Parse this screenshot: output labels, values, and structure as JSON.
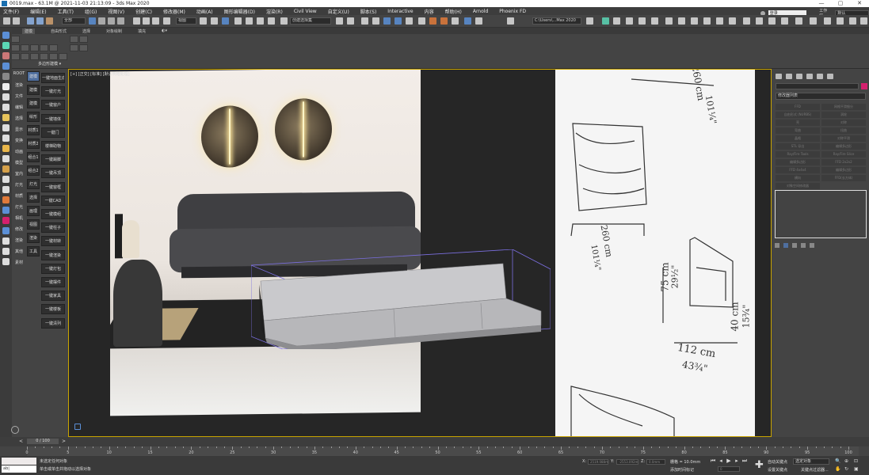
{
  "window": {
    "title": "0019.max - 63.1M @ 2021-11-03 21:13:09 - 3ds Max 2020",
    "controls": [
      "—",
      "▢",
      "✕"
    ]
  },
  "menu": {
    "items": [
      "文件(F)",
      "编辑(E)",
      "工具(T)",
      "组(G)",
      "视图(V)",
      "创建(C)",
      "修改器(M)",
      "动画(A)",
      "图形编辑器(D)",
      "渲染(R)",
      "Civil View",
      "自定义(U)",
      "脚本(S)",
      "Interactive",
      "内容",
      "帮助(H)",
      "Arnold",
      "Phoenix FD"
    ],
    "signin": "登录",
    "workspace_label": "工作区:",
    "workspace_value": "默认"
  },
  "toolbar": {
    "select_filter": "全部",
    "view_ref": "视图",
    "named_selection": "创建选择集",
    "project_path": "C:\\Users\\...Max 2020"
  },
  "ribbon": {
    "tabs": [
      "建模",
      "自由形式",
      "选择",
      "对象绘制",
      "填充"
    ],
    "active_tab": "建模",
    "polygon_label": "多边形建模 ▾"
  },
  "sidebar": {
    "labels": [
      "ROOT",
      "渲染",
      "文件",
      "编辑",
      "选择",
      "显示",
      "变换",
      "动画",
      "模型",
      "室内",
      "灯光",
      "材质",
      "灯光",
      "相机",
      "修改",
      "渲染",
      "其他",
      "素材"
    ]
  },
  "panel": {
    "col1": [
      "建模",
      "建模",
      "建模",
      "绘形",
      "材质1",
      "材质2",
      "组合1",
      "组合2",
      "灯光",
      "选择",
      "画理",
      "视图",
      "渲染",
      "工具"
    ],
    "col2": [
      "一键地面生成",
      "一键灯光",
      "一键窗户",
      "一键墙体",
      "一键门",
      "楼梯助物",
      "一键踢脚",
      "一键吊顶",
      "一键窗框",
      "一键CAD",
      "一键模组",
      "一键柱子",
      "一键材转",
      "一键渲染",
      "一键灯包",
      "一键摆件",
      "一键家具",
      "一键楼板",
      "一键清列"
    ]
  },
  "viewport": {
    "label": "[+] [正交] [标准] [默认明暗处理]"
  },
  "dimensions": {
    "top": "260 cm",
    "top_in": "101¼\"",
    "left": "260 cm",
    "left_in": "101¼\"",
    "depth": "112 cm",
    "depth_in": "43¾\"",
    "height": "75 cm",
    "height_in": "29½\"",
    "seat": "40 cm",
    "seat_in": "15¾\""
  },
  "command_panel": {
    "modifier_list": "修改器列表",
    "buttons": [
      "FFD",
      "网格平滑细分",
      "自由形式 (NURBS)",
      "涡轮",
      "壳",
      "对称",
      "弯曲",
      "扭曲",
      "晶格",
      "对称平滑",
      "STL 导出",
      "编辑多边形",
      "Ray/Fire Tools",
      "Ray/Fire Slice",
      "编辑多边形",
      "FFD 2x2x2",
      "FFD 4x4x4",
      "编辑多边形",
      "横向",
      "FFD(长方体)",
      "对象空间修改器"
    ]
  },
  "timeline": {
    "frame": "0 / 100",
    "ticks": [
      0,
      5,
      10,
      15,
      20,
      25,
      30,
      35,
      40,
      45,
      50,
      55,
      60,
      65,
      70,
      75,
      80,
      85,
      90,
      95,
      100
    ]
  },
  "status": {
    "maxscript": "",
    "maxscript2": "ab|",
    "line1": "未选定任何对象",
    "line2": "单击或单击并拖动以选择对象",
    "x_label": "X:",
    "x_value": "2519.088m",
    "y_label": "Y:",
    "y_value": "-2553.092m",
    "z_label": "Z:",
    "z_value": "0.0mm",
    "grid": "栅格 = 10.0mm",
    "add_time_tag": "添加时间标记",
    "autokey": "自动关键点",
    "setkey": "设置关键点",
    "selected": "选定对象",
    "key_filters": "关键点过滤器...",
    "frame_value": "0"
  }
}
